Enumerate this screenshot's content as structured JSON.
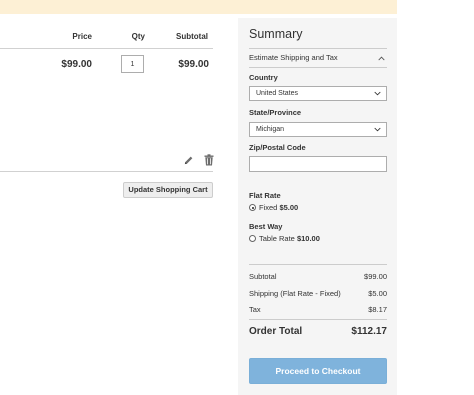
{
  "cart": {
    "headers": {
      "price": "Price",
      "qty": "Qty",
      "subtotal": "Subtotal"
    },
    "item": {
      "price": "$99.00",
      "qty": "1",
      "subtotal": "$99.00"
    },
    "update_button": "Update Shopping Cart",
    "icons": {
      "edit": "pencil-icon",
      "delete": "trash-icon"
    }
  },
  "summary": {
    "title": "Summary",
    "estimate_toggle": "Estimate Shipping and Tax",
    "country_label": "Country",
    "country_value": "United States",
    "state_label": "State/Province",
    "state_value": "Michigan",
    "zip_label": "Zip/Postal Code",
    "zip_value": "",
    "shipping_methods": [
      {
        "carrier": "Flat Rate",
        "option": "Fixed",
        "price": "$5.00",
        "selected": true
      },
      {
        "carrier": "Best Way",
        "option": "Table Rate",
        "price": "$10.00",
        "selected": false
      }
    ],
    "totals": {
      "subtotal_label": "Subtotal",
      "subtotal_value": "$99.00",
      "shipping_label": "Shipping (Flat Rate - Fixed)",
      "shipping_value": "$5.00",
      "tax_label": "Tax",
      "tax_value": "$8.17",
      "order_total_label": "Order Total",
      "order_total_value": "$112.17"
    },
    "checkout_button": "Proceed to Checkout"
  },
  "colors": {
    "banner": "#fdf0d5",
    "summary_bg": "#f5f5f5",
    "checkout_button": "#7fb3dc"
  }
}
